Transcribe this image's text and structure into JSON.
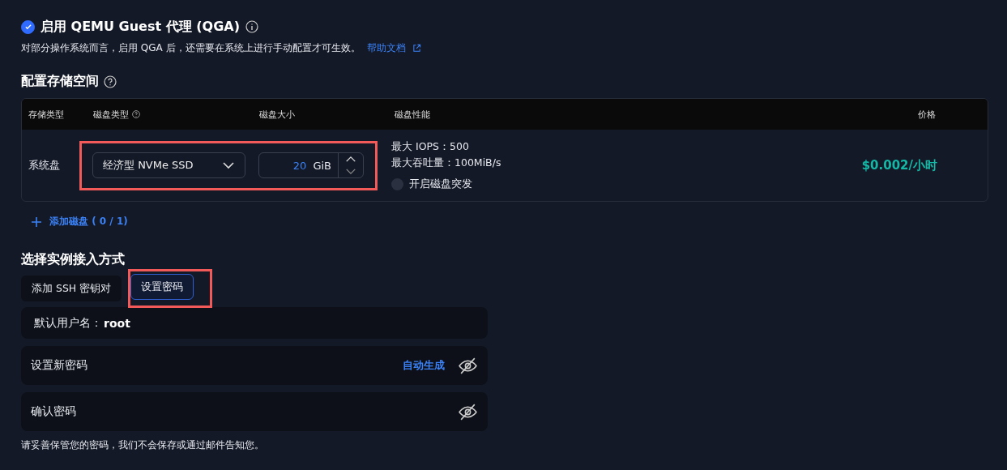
{
  "qga": {
    "checked": true,
    "title": "启用 QEMU Guest 代理 (QGA)",
    "description": "对部分操作系统而言，启用 QGA 后，还需要在系统上进行手动配置才可生效。",
    "help_link": "帮助文档"
  },
  "storage": {
    "title": "配置存储空间",
    "columns": [
      {
        "label": "存储类型",
        "help": false
      },
      {
        "label": "磁盘类型",
        "help": true
      },
      {
        "label": "磁盘大小",
        "help": false
      },
      {
        "label": "磁盘性能",
        "help": false
      },
      {
        "label": "价格",
        "help": false
      }
    ],
    "rows": [
      {
        "storage_type": "系统盘",
        "disk_type": "经济型 NVMe SSD",
        "size_value": "20",
        "size_unit": "GiB",
        "performance": [
          "最大 IOPS：500",
          "最大吞吐量：100MiB/s"
        ],
        "burst": {
          "label": "开启磁盘突发",
          "checked": false
        },
        "price": "$0.002/小时"
      }
    ],
    "add_button": "添加磁盘 ( 0 / 1)"
  },
  "access": {
    "title": "选择实例接入方式",
    "tabs": [
      {
        "label": "添加 SSH 密钥对",
        "selected": false
      },
      {
        "label": "设置密码",
        "selected": true
      }
    ],
    "username_label": "默认用户名：",
    "username_value": "root",
    "fields": [
      {
        "label": "设置新密码",
        "action": "自动生成"
      },
      {
        "label": "确认密码"
      }
    ],
    "note": "请妥善保管您的密码，我们不会保存或通过邮件告知您。"
  }
}
